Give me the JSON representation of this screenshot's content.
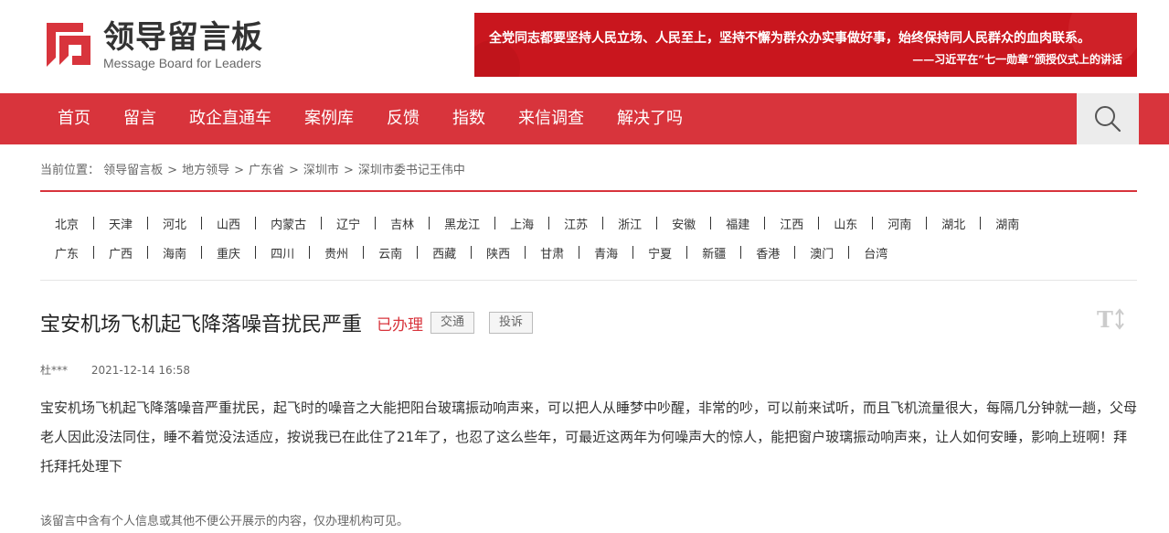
{
  "header": {
    "logo_cn": "领导留言板",
    "logo_en": "Message Board for Leaders",
    "banner_line1": "全党同志都要坚持人民立场、人民至上，坚持不懈为群众办实事做好事，始终保持同人民群众的血肉联系。",
    "banner_line2": "——习近平在“七一勋章”颁授仪式上的讲话"
  },
  "nav": {
    "items": [
      "首页",
      "留言",
      "政企直通车",
      "案例库",
      "反馈",
      "指数",
      "来信调查",
      "解决了吗"
    ],
    "search_icon": "search-icon"
  },
  "breadcrumb": {
    "prefix": "当前位置：",
    "items": [
      "领导留言板",
      "地方领导",
      "广东省",
      "深圳市",
      "深圳市委书记王伟中"
    ],
    "separator": ">"
  },
  "regions": {
    "row1": [
      "北京",
      "天津",
      "河北",
      "山西",
      "内蒙古",
      "辽宁",
      "吉林",
      "黑龙江",
      "上海",
      "江苏",
      "浙江",
      "安徽",
      "福建",
      "江西",
      "山东",
      "河南",
      "湖北",
      "湖南"
    ],
    "row2": [
      "广东",
      "广西",
      "海南",
      "重庆",
      "四川",
      "贵州",
      "云南",
      "西藏",
      "陕西",
      "甘肃",
      "青海",
      "宁夏",
      "新疆",
      "香港",
      "澳门",
      "台湾"
    ]
  },
  "message": {
    "title": "宝安机场飞机起飞降落噪音扰民严重",
    "status": "已办理",
    "tag": "交通",
    "complaint": "投诉",
    "author": "杜***",
    "date": "2021-12-14 16:58",
    "body": "宝安机场飞机起飞降落噪音严重扰民，起飞时的噪音之大能把阳台玻璃振动响声来，可以把人从睡梦中吵醒，非常的吵，可以前来试听，而且飞机流量很大，每隔几分钟就一趟，父母老人因此没法同住，睡不着觉没法适应，按说我已在此住了21年了，也忍了这么些年，可最近这两年为何噪声大的惊人，能把窗户玻璃振动响声来，让人如何安睡，影响上班啊！拜托拜托处理下",
    "privacy_note": "该留言中含有个人信息或其他不便公开展示的内容，仅办理机构可见。"
  },
  "colors": {
    "brand_red": "#d8343c",
    "banner_red": "#c9161e"
  }
}
